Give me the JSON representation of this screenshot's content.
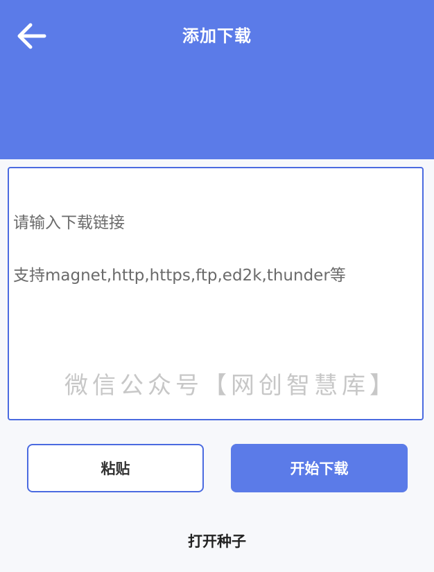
{
  "header": {
    "title": "添加下载",
    "back_icon": "arrow-left-icon",
    "background": "#5b7be8"
  },
  "link_input": {
    "placeholder_line1": "请输入下载链接",
    "placeholder_line2": "支持magnet,http,https,ftp,ed2k,thunder等",
    "watermark": "微信公众号【网创智慧库】",
    "border_color": "#4a6ae0"
  },
  "actions": {
    "paste_label": "粘贴",
    "start_label": "开始下载",
    "open_seed_label": "打开种子"
  },
  "colors": {
    "accent": "#5b7be8"
  }
}
